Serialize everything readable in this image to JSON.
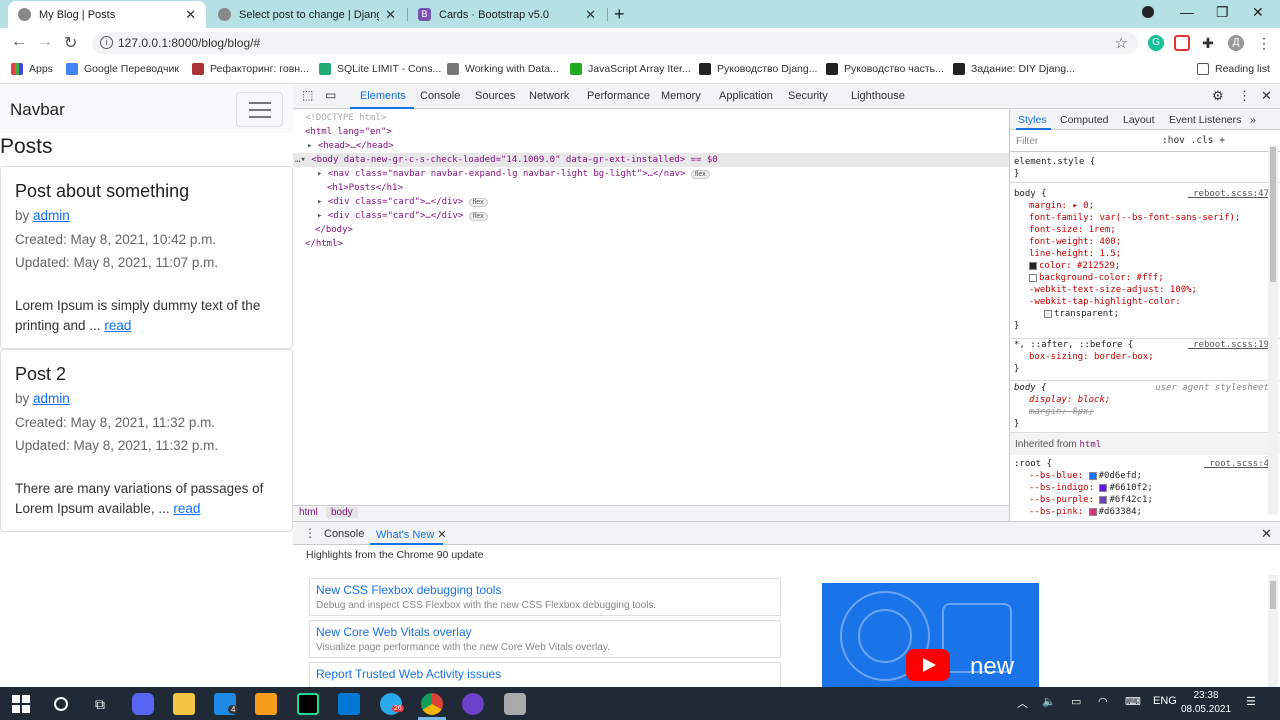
{
  "tabs": [
    {
      "title": "My Blog | Posts",
      "active": true
    },
    {
      "title": "Select post to change | Django si",
      "active": false
    },
    {
      "title": "Cards · Bootstrap v5.0",
      "active": false
    }
  ],
  "url": "127.0.0.1:8000/blog/blog/#",
  "bookmarks": [
    {
      "label": "Apps",
      "color": "#d44"
    },
    {
      "label": "Google Переводчик",
      "color": "#4285f4"
    },
    {
      "label": "Рефакторинг: говн...",
      "color": "#a33"
    },
    {
      "label": "SQLite LIMIT - Cons...",
      "color": "#2a7"
    },
    {
      "label": "Working with Data...",
      "color": "#777"
    },
    {
      "label": "JavaScript Array Iter...",
      "color": "#2a2"
    },
    {
      "label": "Руководство Djang...",
      "color": "#222"
    },
    {
      "label": "Руководство часть...",
      "color": "#222"
    },
    {
      "label": "Задание: DIY Djang...",
      "color": "#222"
    }
  ],
  "reading_list": "Reading list",
  "page": {
    "brand": "Navbar",
    "heading": "Posts",
    "posts": [
      {
        "title": "Post about something",
        "by": "by",
        "author": "admin",
        "created": "Created: May 8, 2021, 10:42 p.m.",
        "updated": "Updated: May 8, 2021, 11:07 p.m.",
        "excerpt": "Lorem Ipsum is simply dummy text of the printing and ...",
        "read": "read"
      },
      {
        "title": "Post 2",
        "by": "by",
        "author": "admin",
        "created": "Created: May 8, 2021, 11:32 p.m.",
        "updated": "Updated: May 8, 2021, 11:32 p.m.",
        "excerpt": "There are many variations of passages of Lorem Ipsum available, ...",
        "read": "read"
      }
    ]
  },
  "devtools": {
    "tabs": [
      "Elements",
      "Console",
      "Sources",
      "Network",
      "Performance",
      "Memory",
      "Application",
      "Security",
      "Lighthouse"
    ],
    "dom": {
      "doctype": "<!DOCTYPE html>",
      "html_open": "<html lang=\"en\">",
      "head": "<head>…</head>",
      "body_line": "<body data-new-gr-c-s-check-loaded=\"14.1009.0\" data-gr-ext-installed> == $0",
      "nav_line": "<nav class=\"navbar navbar-expand-lg navbar-light bg-light\">…</nav>",
      "h1_line": "<h1>Posts</h1>",
      "card_line": "<div class=\"card\">…</div>",
      "body_close": "</body>",
      "html_close": "</html>",
      "pill": "flex"
    },
    "breadcrumbs": [
      "html",
      "body"
    ],
    "styles_tabs": [
      "Styles",
      "Computed",
      "Layout",
      "Event Listeners"
    ],
    "filter_placeholder": "Filter",
    "filter_opts": ":hov  .cls  +",
    "element_style": "element.style {",
    "close_brace": "}",
    "body_rule": {
      "selector": "body {",
      "source": "_reboot.scss:47",
      "props": [
        "margin: ▸ 0;",
        "font-family: var(--bs-font-sans-serif);",
        "font-size: 1rem;",
        "font-weight: 400;",
        "line-height: 1.5;",
        "color: #212529;",
        "background-color: #fff;",
        "-webkit-text-size-adjust: 100%;",
        "-webkit-tap-highlight-color:",
        "transparent;"
      ]
    },
    "star_rule": {
      "selector": "*, ::after, ::before {",
      "source": "_reboot.scss:19",
      "prop": "box-sizing: border-box;"
    },
    "ua_rule": {
      "selector": "body {",
      "source": "user agent stylesheet",
      "props": [
        "display: block;",
        "margin: 8px;"
      ]
    },
    "inherited": "Inherited from",
    "inherited_tag": "html",
    "root_rule": {
      "selector": ":root {",
      "source": "_root.scss:4",
      "vars": [
        {
          "name": "--bs-blue:",
          "value": "#0d6efd;",
          "color": "#0d6efd"
        },
        {
          "name": "--bs-indigo:",
          "value": "#6610f2;",
          "color": "#6610f2"
        },
        {
          "name": "--bs-purple:",
          "value": "#6f42c1;",
          "color": "#6f42c1"
        },
        {
          "name": "--bs-pink:",
          "value": "#d63384;",
          "color": "#d63384"
        }
      ]
    },
    "drawer_tabs": [
      "Console",
      "What's New"
    ],
    "highlights": "Highlights from the Chrome 90 update",
    "whats_new": [
      {
        "title": "New CSS Flexbox debugging tools",
        "desc": "Debug and inspect CSS Flexbox with the new CSS Flexbox debugging tools."
      },
      {
        "title": "New Core Web Vitals overlay",
        "desc": "Visualize page performance with the new Core Web Vitals overlay."
      },
      {
        "title": "Report Trusted Web Activity issues",
        "desc": ""
      }
    ],
    "promo_text": "new"
  },
  "taskbar": {
    "lang": "ENG",
    "time": "23:38",
    "date": "08.05.2021",
    "badge_mail": "4",
    "badge_telegram": "26"
  },
  "colors": {
    "accent": "#1a73e8",
    "link": "#0d6efd",
    "tabstrip": "#b5e0e4",
    "taskbar": "#1f2a36"
  }
}
